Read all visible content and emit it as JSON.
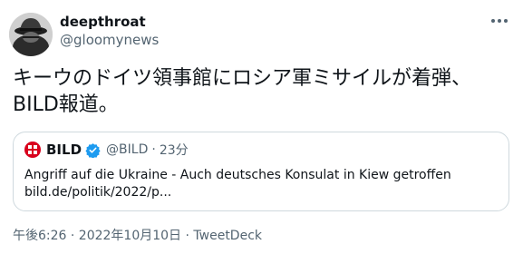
{
  "user": {
    "display_name": "deepthroat",
    "handle": "@gloomynews"
  },
  "tweet": {
    "text": "キーウのドイツ領事館にロシア軍ミサイルが着弾、\nBILD報道。"
  },
  "quoted": {
    "name": "BILD",
    "handle": "@BILD",
    "separator": "·",
    "time": "23分",
    "text": "Angriff auf die Ukraine - Auch deutsches Konsulat in Kiew getroffen",
    "link": "bild.de/politik/2022/p..."
  },
  "footer": {
    "timestamp": "午後6:26 · 2022年10月10日 · ",
    "source": "TweetDeck"
  },
  "colors": {
    "text": "#0f1419",
    "secondary": "#536471",
    "border": "#cfd9de",
    "verified": "#1d9bf0",
    "bild_red": "#d9001d"
  },
  "icons": {
    "avatar": "detective-hat-avatar",
    "more": "more-dots-icon",
    "verified": "verified-badge-icon",
    "bild_logo": "bild-logo"
  }
}
